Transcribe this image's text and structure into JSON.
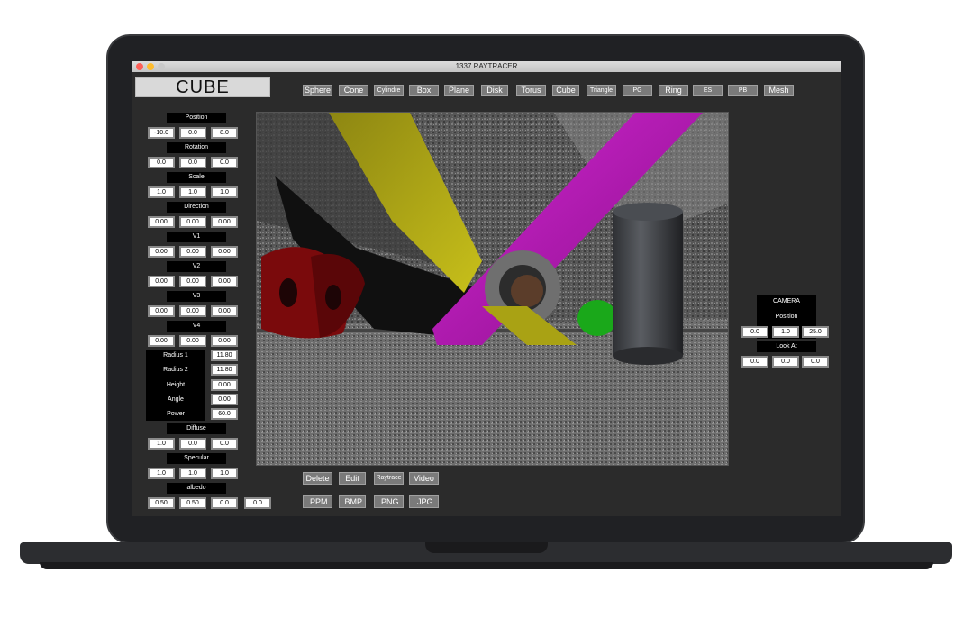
{
  "window": {
    "title": "1337 RAYTRACER"
  },
  "object_title": "CUBE",
  "shape_buttons": [
    "Sphere",
    "Cone",
    "Cylindre",
    "Box",
    "Plane",
    "Disk",
    "Torus",
    "Cube",
    "Triangle",
    "PG",
    "Ring",
    "ES",
    "PB",
    "Mesh"
  ],
  "params": {
    "position": {
      "label": "Position",
      "values": [
        "-10.0",
        "0.0",
        "8.0"
      ]
    },
    "rotation": {
      "label": "Rotation",
      "values": [
        "0.0",
        "0.0",
        "0.0"
      ]
    },
    "scale": {
      "label": "Scale",
      "values": [
        "1.0",
        "1.0",
        "1.0"
      ]
    },
    "direction": {
      "label": "Direction",
      "values": [
        "0.00",
        "0.00",
        "0.00"
      ]
    },
    "v1": {
      "label": "V1",
      "values": [
        "0.00",
        "0.00",
        "0.00"
      ]
    },
    "v2": {
      "label": "V2",
      "values": [
        "0.00",
        "0.00",
        "0.00"
      ]
    },
    "v3": {
      "label": "V3",
      "values": [
        "0.00",
        "0.00",
        "0.00"
      ]
    },
    "v4": {
      "label": "V4",
      "values": [
        "0.00",
        "0.00",
        "0.00"
      ]
    },
    "radius1": {
      "label": "Radius 1",
      "value": "11.80"
    },
    "radius2": {
      "label": "Radius 2",
      "value": "11.80"
    },
    "height": {
      "label": "Height",
      "value": "0.00"
    },
    "angle": {
      "label": "Angle",
      "value": "0.00"
    },
    "power": {
      "label": "Power",
      "value": "60.0"
    },
    "diffuse": {
      "label": "Diffuse",
      "values": [
        "1.0",
        "0.0",
        "0.0"
      ]
    },
    "specular": {
      "label": "Specular",
      "values": [
        "1.0",
        "1.0",
        "1.0"
      ]
    },
    "albedo": {
      "label": "albedo",
      "values": [
        "0.50",
        "0.50",
        "0.0",
        "0.0"
      ]
    }
  },
  "camera": {
    "title": "CAMERA",
    "position_label": "Position",
    "position": [
      "0.0",
      "1.0",
      "25.0"
    ],
    "look_at_label": "Look At",
    "look_at": [
      "0.0",
      "0.0",
      "0.0"
    ]
  },
  "actions": [
    "Delete",
    "Edit",
    "Raytrace",
    "Video"
  ],
  "exports": [
    ".PPM",
    ".BMP",
    ".PNG",
    ".JPG"
  ],
  "colors": {
    "yellow": "#a9a214",
    "magenta": "#b418b4",
    "red": "#7a0a0c",
    "green": "#1aa81a",
    "pillar": "#3d3f44"
  }
}
